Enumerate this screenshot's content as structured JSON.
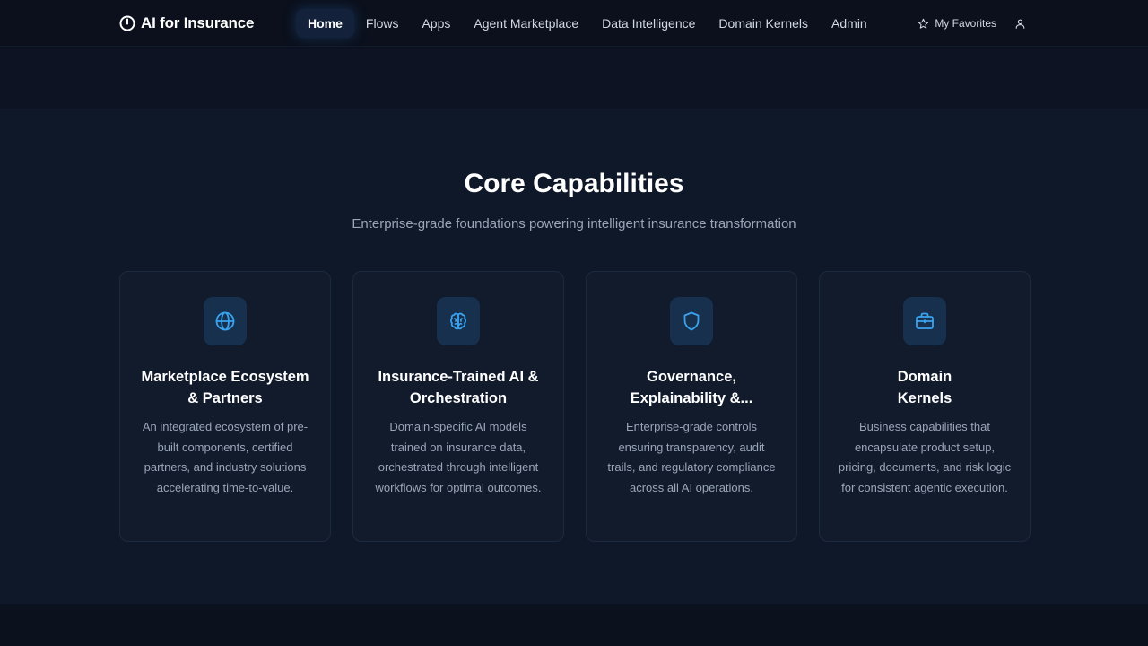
{
  "header": {
    "app_title": "AI for Insurance",
    "nav": [
      {
        "label": "Home",
        "active": true
      },
      {
        "label": "Flows",
        "active": false
      },
      {
        "label": "Apps",
        "active": false
      },
      {
        "label": "Agent Marketplace",
        "active": false
      },
      {
        "label": "Data Intelligence",
        "active": false
      },
      {
        "label": "Domain Kernels",
        "active": false
      },
      {
        "label": "Admin",
        "active": false
      }
    ],
    "favorites_label": "My Favorites"
  },
  "capabilities": {
    "title": "Core Capabilities",
    "subtitle": "Enterprise-grade foundations powering intelligent insurance transformation",
    "cards": [
      {
        "icon": "globe-icon",
        "title": "Marketplace Ecosystem\n& Partners",
        "description": "An integrated ecosystem of pre-built components, certified partners, and industry solutions accelerating time-to-value."
      },
      {
        "icon": "brain-icon",
        "title": "Insurance-Trained AI &\nOrchestration",
        "description": "Domain-specific AI models trained on insurance data, orchestrated through intelligent workflows for optimal outcomes."
      },
      {
        "icon": "shield-icon",
        "title": "Governance,\nExplainability &...",
        "description": "Enterprise-grade controls ensuring transparency, audit trails, and regulatory compliance across all AI operations."
      },
      {
        "icon": "briefcase-icon",
        "title": "Domain\nKernels",
        "description": "Business capabilities that encapsulate product setup, pricing, documents, and risk logic for consistent agentic execution."
      }
    ]
  },
  "colors": {
    "accent": "#3aa3f0",
    "background": "#0f1828",
    "card": "#111b2c"
  }
}
